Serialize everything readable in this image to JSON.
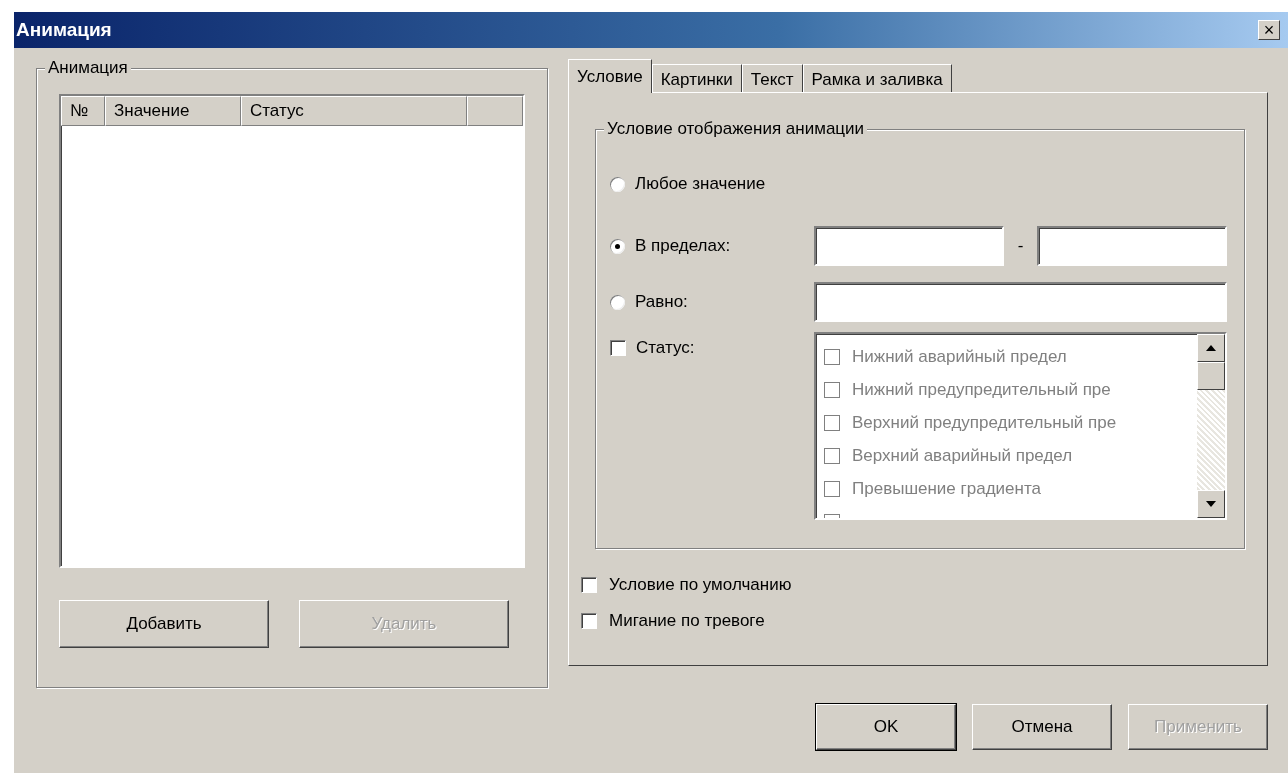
{
  "window": {
    "title": "Анимация",
    "close": "×"
  },
  "animation_group": {
    "title": "Анимация",
    "table": {
      "columns": [
        "№",
        "Значение",
        "Статус"
      ]
    },
    "buttons": [
      {
        "label": "Добавить",
        "disabled": false
      },
      {
        "label": "Удалить",
        "disabled": true
      }
    ]
  },
  "tabs": [
    {
      "label": "Условие",
      "selected": true
    },
    {
      "label": "Картинки",
      "selected": false
    },
    {
      "label": "Текст",
      "selected": false
    },
    {
      "label": "Рамка и заливка",
      "selected": false
    }
  ],
  "condition_group": {
    "title": "Условие отображения анимации",
    "options": [
      {
        "kind": "radio",
        "label": "Любое значение",
        "selected": false
      },
      {
        "kind": "range",
        "label": "В пределах:",
        "selected": true,
        "separator": "-"
      },
      {
        "kind": "equal",
        "label": "Равно:",
        "selected": false
      },
      {
        "kind": "status",
        "label": "Статус:",
        "checked": false,
        "disabled": true,
        "items": [
          {
            "label": "Нижний аварийный предел",
            "checked": false
          },
          {
            "label": "Нижний предупредительный пре",
            "checked": false
          },
          {
            "label": "Верхний предупредительный пре",
            "checked": false
          },
          {
            "label": "Верхний аварийный предел",
            "checked": false
          },
          {
            "label": "Превышение градиента",
            "checked": false
          }
        ]
      }
    ]
  },
  "checkboxes": [
    {
      "label": "Условие по умолчанию",
      "checked": false
    },
    {
      "label": "Мигание по тревоге",
      "checked": false
    }
  ],
  "footer_buttons": [
    {
      "label": "OK",
      "default": true,
      "disabled": false
    },
    {
      "label": "Отмена",
      "default": false,
      "disabled": false
    },
    {
      "label": "Применить",
      "default": false,
      "disabled": true
    }
  ]
}
